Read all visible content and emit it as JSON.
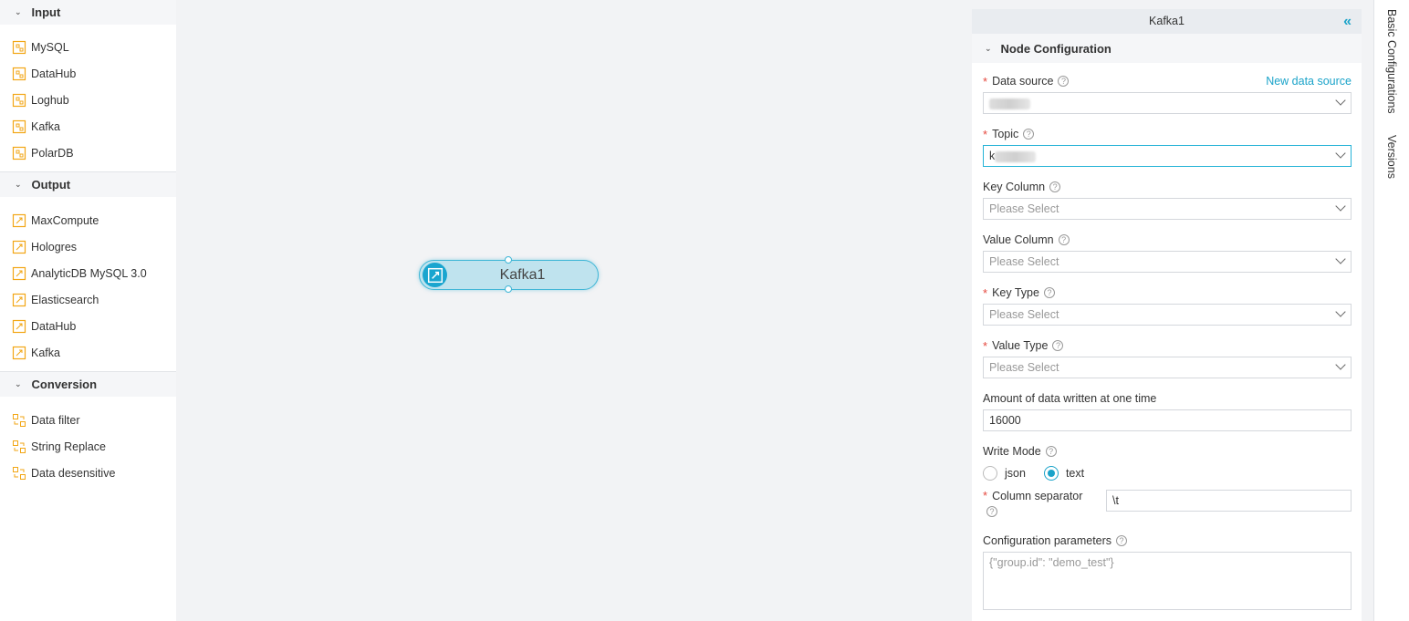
{
  "left_panel": {
    "groups": [
      {
        "title": "Input",
        "items": [
          "MySQL",
          "DataHub",
          "Loghub",
          "Kafka",
          "PolarDB"
        ]
      },
      {
        "title": "Output",
        "items": [
          "MaxCompute",
          "Hologres",
          "AnalyticDB MySQL 3.0",
          "Elasticsearch",
          "DataHub",
          "Kafka"
        ]
      },
      {
        "title": "Conversion",
        "items": [
          "Data filter",
          "String Replace",
          "Data desensitive"
        ]
      }
    ]
  },
  "canvas": {
    "node_label": "Kafka1"
  },
  "config": {
    "title": "Kafka1",
    "collapse_icon": "«",
    "section_title": "Node Configuration",
    "data_source_label": "Data source",
    "new_data_source_link": "New data source",
    "topic_label": "Topic",
    "topic_prefix": "k",
    "key_column_label": "Key Column",
    "key_column_placeholder": "Please Select",
    "value_column_label": "Value Column",
    "value_column_placeholder": "Please Select",
    "key_type_label": "Key Type",
    "key_type_placeholder": "Please Select",
    "value_type_label": "Value Type",
    "value_type_placeholder": "Please Select",
    "amount_label": "Amount of data written at one time",
    "amount_value": "16000",
    "write_mode_label": "Write Mode",
    "write_mode_options": [
      "json",
      "text"
    ],
    "write_mode_selected": "text",
    "column_separator_label": "Column separator",
    "column_separator_value": "\\t",
    "config_params_label": "Configuration parameters",
    "config_params_placeholder": "{\"group.id\": \"demo_test\"}"
  },
  "vertical_tabs": [
    "Basic Configurations",
    "Versions"
  ],
  "colors": {
    "accent": "#1aa3c9",
    "required": "#e5483e",
    "node_fill": "#bfe3ee"
  }
}
